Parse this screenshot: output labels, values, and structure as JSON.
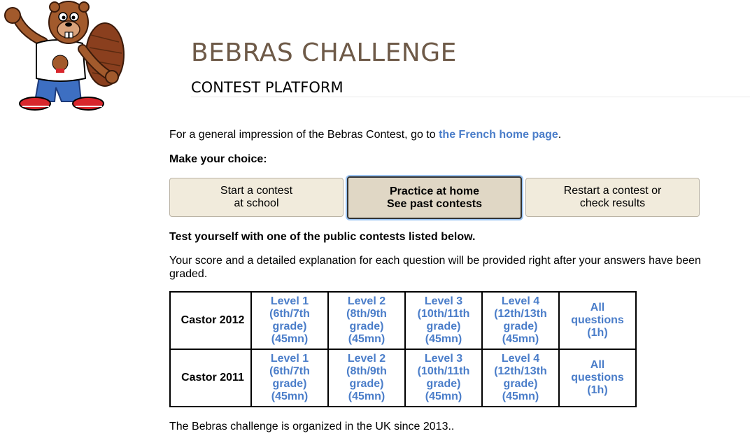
{
  "header": {
    "title": "BEBRAS CHALLENGE",
    "subtitle": "CONTEST PLATFORM"
  },
  "intro": {
    "text_before": "For a general impression of the Bebras Contest, go to ",
    "link": "the French home page",
    "text_after": "."
  },
  "choose_label": "Make your choice:",
  "choices": [
    {
      "line1": "Start a contest",
      "line2": "at school"
    },
    {
      "line1": "Practice at home",
      "line2": "See past contests"
    },
    {
      "line1": "Restart a contest or",
      "line2": "check results"
    }
  ],
  "test_yourself": "Test yourself with one of the public contests listed below.",
  "score_text": "Your score and a detailed explanation for each question will be provided right after your answers have been graded.",
  "contests": [
    {
      "name": "Castor 2012",
      "levels": [
        {
          "l1": "Level 1",
          "l2": "(6th/7th",
          "l3": "grade)",
          "l4": "(45mn)"
        },
        {
          "l1": "Level 2",
          "l2": "(8th/9th",
          "l3": "grade)",
          "l4": "(45mn)"
        },
        {
          "l1": "Level 3",
          "l2": "(10th/11th",
          "l3": "grade)",
          "l4": "(45mn)"
        },
        {
          "l1": "Level 4",
          "l2": "(12th/13th",
          "l3": "grade)",
          "l4": "(45mn)"
        },
        {
          "l1": "All",
          "l2": "questions",
          "l3": "(1h)",
          "l4": ""
        }
      ]
    },
    {
      "name": "Castor 2011",
      "levels": [
        {
          "l1": "Level 1",
          "l2": "(6th/7th",
          "l3": "grade)",
          "l4": "(45mn)"
        },
        {
          "l1": "Level 2",
          "l2": "(8th/9th",
          "l3": "grade)",
          "l4": "(45mn)"
        },
        {
          "l1": "Level 3",
          "l2": "(10th/11th",
          "l3": "grade)",
          "l4": "(45mn)"
        },
        {
          "l1": "Level 4",
          "l2": "(12th/13th",
          "l3": "grade)",
          "l4": "(45mn)"
        },
        {
          "l1": "All",
          "l2": "questions",
          "l3": "(1h)",
          "l4": ""
        }
      ]
    }
  ],
  "footer": "The Bebras challenge is organized in the UK since 2013..",
  "colors": {
    "title": "#6e5a48",
    "link": "#4a7dc9",
    "button_bg": "#f1ebdc",
    "button_selected_bg": "#e0d7c5",
    "focus_ring": "#9cc4f2"
  },
  "icons": {
    "mascot": "beaver-mascot-icon"
  }
}
